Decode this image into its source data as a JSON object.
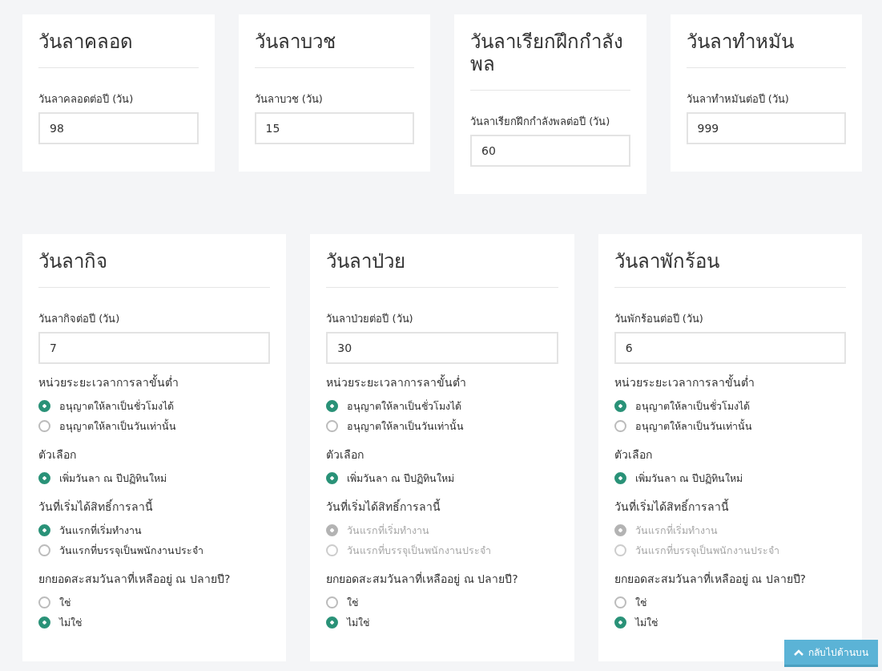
{
  "top_cards": [
    {
      "title": "วันลาคลอด",
      "field_label": "วันลาคลอดต่อปี (วัน)",
      "value": "98"
    },
    {
      "title": "วันลาบวช",
      "field_label": "วันลาบวช (วัน)",
      "value": "15"
    },
    {
      "title": "วันลาเรียกฝึกกำลังพล",
      "field_label": "วันลาเรียกฝึกกำลังพลต่อปี (วัน)",
      "value": "60"
    },
    {
      "title": "วันลาทำหมัน",
      "field_label": "วันลาทำหมันต่อปี (วัน)",
      "value": "999"
    }
  ],
  "detail_cards": [
    {
      "title": "วันลากิจ",
      "field_label": "วันลากิจต่อปี (วัน)",
      "value": "7",
      "groups": [
        {
          "heading": "หน่วยระยะเวลาการลาขั้นต่ำ",
          "options": [
            {
              "label": "อนุญาตให้ลาเป็นชั่วโมงได้",
              "selected": true,
              "disabled": false
            },
            {
              "label": "อนุญาตให้ลาเป็นวันเท่านั้น",
              "selected": false,
              "disabled": false
            }
          ]
        },
        {
          "heading": "ตัวเลือก",
          "options": [
            {
              "label": "เพิ่มวันลา ณ ปีปฏิทินใหม่",
              "selected": true,
              "disabled": false
            }
          ]
        },
        {
          "heading": "วันที่เริ่มได้สิทธิ์การลานี้",
          "options": [
            {
              "label": "วันแรกที่เริ่มทำงาน",
              "selected": true,
              "disabled": false
            },
            {
              "label": "วันแรกที่บรรจุเป็นพนักงานประจำ",
              "selected": false,
              "disabled": false
            }
          ]
        },
        {
          "heading": "ยกยอดสะสมวันลาที่เหลืออยู่ ณ ปลายปี?",
          "options": [
            {
              "label": "ใช่",
              "selected": false,
              "disabled": false
            },
            {
              "label": "ไม่ใช่",
              "selected": true,
              "disabled": false
            }
          ]
        }
      ]
    },
    {
      "title": "วันลาป่วย",
      "field_label": "วันลาป่วยต่อปี (วัน)",
      "value": "30",
      "groups": [
        {
          "heading": "หน่วยระยะเวลาการลาขั้นต่ำ",
          "options": [
            {
              "label": "อนุญาตให้ลาเป็นชั่วโมงได้",
              "selected": true,
              "disabled": false
            },
            {
              "label": "อนุญาตให้ลาเป็นวันเท่านั้น",
              "selected": false,
              "disabled": false
            }
          ]
        },
        {
          "heading": "ตัวเลือก",
          "options": [
            {
              "label": "เพิ่มวันลา ณ ปีปฏิทินใหม่",
              "selected": true,
              "disabled": false
            }
          ]
        },
        {
          "heading": "วันที่เริ่มได้สิทธิ์การลานี้",
          "options": [
            {
              "label": "วันแรกที่เริ่มทำงาน",
              "selected": true,
              "disabled": true
            },
            {
              "label": "วันแรกที่บรรจุเป็นพนักงานประจำ",
              "selected": false,
              "disabled": true
            }
          ]
        },
        {
          "heading": "ยกยอดสะสมวันลาที่เหลืออยู่ ณ ปลายปี?",
          "options": [
            {
              "label": "ใช่",
              "selected": false,
              "disabled": false
            },
            {
              "label": "ไม่ใช่",
              "selected": true,
              "disabled": false
            }
          ]
        }
      ]
    },
    {
      "title": "วันลาพักร้อน",
      "field_label": "วันพักร้อนต่อปี (วัน)",
      "value": "6",
      "groups": [
        {
          "heading": "หน่วยระยะเวลาการลาขั้นต่ำ",
          "options": [
            {
              "label": "อนุญาตให้ลาเป็นชั่วโมงได้",
              "selected": true,
              "disabled": false
            },
            {
              "label": "อนุญาตให้ลาเป็นวันเท่านั้น",
              "selected": false,
              "disabled": false
            }
          ]
        },
        {
          "heading": "ตัวเลือก",
          "options": [
            {
              "label": "เพิ่มวันลา ณ ปีปฏิทินใหม่",
              "selected": true,
              "disabled": false
            }
          ]
        },
        {
          "heading": "วันที่เริ่มได้สิทธิ์การลานี้",
          "options": [
            {
              "label": "วันแรกที่เริ่มทำงาน",
              "selected": true,
              "disabled": true
            },
            {
              "label": "วันแรกที่บรรจุเป็นพนักงานประจำ",
              "selected": false,
              "disabled": true
            }
          ]
        },
        {
          "heading": "ยกยอดสะสมวันลาที่เหลืออยู่ ณ ปลายปี?",
          "options": [
            {
              "label": "ใช่",
              "selected": false,
              "disabled": false
            },
            {
              "label": "ไม่ใช่",
              "selected": true,
              "disabled": false
            }
          ]
        }
      ]
    }
  ],
  "back_to_top_button": {
    "label": "กลับไปด้านบน"
  }
}
